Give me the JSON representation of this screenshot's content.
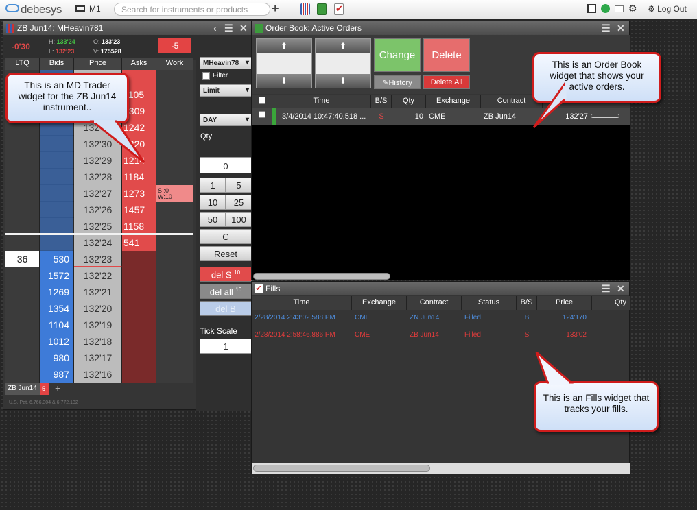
{
  "topbar": {
    "logo": "debesys",
    "monitor": "M1",
    "search_placeholder": "Search for instruments or products",
    "logout": "Log Out"
  },
  "md_trader": {
    "title": "ZB Jun14: MHeavin781",
    "ltq_change": "-0'30",
    "high_label": "H:",
    "high": "133'24",
    "low_label": "L:",
    "low": "132'23",
    "open_label": "O:",
    "open": "133'23",
    "vol_label": "V:",
    "volume": "175528",
    "position": "-5",
    "columns": [
      "LTQ",
      "Bids",
      "Price",
      "Asks",
      "Work"
    ],
    "rows": [
      {
        "ltq": "",
        "bid": "",
        "price": "",
        "ask": "",
        "work": "",
        "type": "askrow"
      },
      {
        "ltq": "",
        "bid": "",
        "price": "",
        "ask": "1105",
        "work": "",
        "type": "askrow"
      },
      {
        "ltq": "",
        "bid": "",
        "price": "",
        "ask": "1309",
        "work": "",
        "type": "askrow"
      },
      {
        "ltq": "",
        "bid": "",
        "price": "132'31",
        "ask": "1242",
        "work": "",
        "type": "askrow"
      },
      {
        "ltq": "",
        "bid": "",
        "price": "132'30",
        "ask": "1220",
        "work": "",
        "type": "askrow"
      },
      {
        "ltq": "",
        "bid": "",
        "price": "132'29",
        "ask": "1214",
        "work": "",
        "type": "askrow"
      },
      {
        "ltq": "",
        "bid": "",
        "price": "132'28",
        "ask": "1184",
        "work": "",
        "type": "askrow"
      },
      {
        "ltq": "",
        "bid": "",
        "price": "132'27",
        "ask": "1273",
        "work": "S :0\nW:10",
        "type": "askrow"
      },
      {
        "ltq": "",
        "bid": "",
        "price": "132'26",
        "ask": "1457",
        "work": "",
        "type": "askrow"
      },
      {
        "ltq": "",
        "bid": "",
        "price": "132'25",
        "ask": "1158",
        "work": "",
        "type": "askrow"
      },
      {
        "ltq": "",
        "bid": "",
        "price": "132'24",
        "ask": "541",
        "work": "",
        "type": "askrow"
      },
      {
        "ltq": "36",
        "bid": "530",
        "price": "132'23",
        "ask": "",
        "work": "",
        "type": "bidrow"
      },
      {
        "ltq": "",
        "bid": "1572",
        "price": "132'22",
        "ask": "",
        "work": "",
        "type": "bidrow"
      },
      {
        "ltq": "",
        "bid": "1269",
        "price": "132'21",
        "ask": "",
        "work": "",
        "type": "bidrow"
      },
      {
        "ltq": "",
        "bid": "1354",
        "price": "132'20",
        "ask": "",
        "work": "",
        "type": "bidrow"
      },
      {
        "ltq": "",
        "bid": "1104",
        "price": "132'19",
        "ask": "",
        "work": "",
        "type": "bidrow"
      },
      {
        "ltq": "",
        "bid": "1012",
        "price": "132'18",
        "ask": "",
        "work": "",
        "type": "bidrow"
      },
      {
        "ltq": "",
        "bid": "980",
        "price": "132'17",
        "ask": "",
        "work": "",
        "type": "bidrow"
      },
      {
        "ltq": "",
        "bid": "987",
        "price": "132'16",
        "ask": "",
        "work": "",
        "type": "bidrow"
      }
    ],
    "account": "MHeavin78",
    "filter_label": "Filter",
    "order_type": "Limit",
    "tif": "DAY",
    "qty_label": "Qty",
    "qty_value": "0",
    "qty_buttons": [
      "1",
      "5",
      "10",
      "25",
      "50",
      "100"
    ],
    "clear_label": "C",
    "reset_label": "Reset",
    "del_s": "del S",
    "del_s_count": "10",
    "del_all": "del all",
    "del_all_count": "10",
    "del_b": "del B",
    "tick_scale_label": "Tick Scale",
    "tick_scale_value": "1",
    "tab_label": "ZB Jun14",
    "tab_badge": "5",
    "patent": "U.S. Pat. 6,766,304 & 6,772,132"
  },
  "order_book": {
    "title": "Order Book: Active Orders",
    "change_label": "Change",
    "delete_label": "Delete",
    "history_label": "History",
    "delete_all_label": "Delete All",
    "columns": [
      "Time",
      "B/S",
      "Qty",
      "Exchange",
      "Contract"
    ],
    "order": {
      "time": "3/4/2014 10:47:40.518 ...",
      "bs": "S",
      "qty": "10",
      "exchange": "CME",
      "contract": "ZB Jun14",
      "price": "132'27"
    }
  },
  "fills": {
    "title": "Fills",
    "columns": [
      "Time",
      "Exchange",
      "Contract",
      "Status",
      "B/S",
      "Price",
      "Qty"
    ],
    "rows": [
      {
        "time": "2/28/2014 2:43:02.588 PM",
        "exchange": "CME",
        "contract": "ZN Jun14",
        "status": "Filled",
        "bs": "B",
        "price": "124'170",
        "color": "#4f8fe0"
      },
      {
        "time": "2/28/2014 2:58:46.886 PM",
        "exchange": "CME",
        "contract": "ZB Jun14",
        "status": "Filled",
        "bs": "S",
        "price": "133'02",
        "color": "#e23c3c"
      }
    ]
  },
  "callouts": {
    "md": "This is an MD Trader widget for the ZB Jun14 instrument..",
    "ob": "This is an Order Book widget that shows your active orders.",
    "fills": "This is an Fills widget that tracks your fills."
  },
  "colors": {
    "ask": "#e14b4b",
    "bid": "#3e7bd8",
    "accent_green": "#2ea84a",
    "callout_border": "#d01c1c"
  }
}
